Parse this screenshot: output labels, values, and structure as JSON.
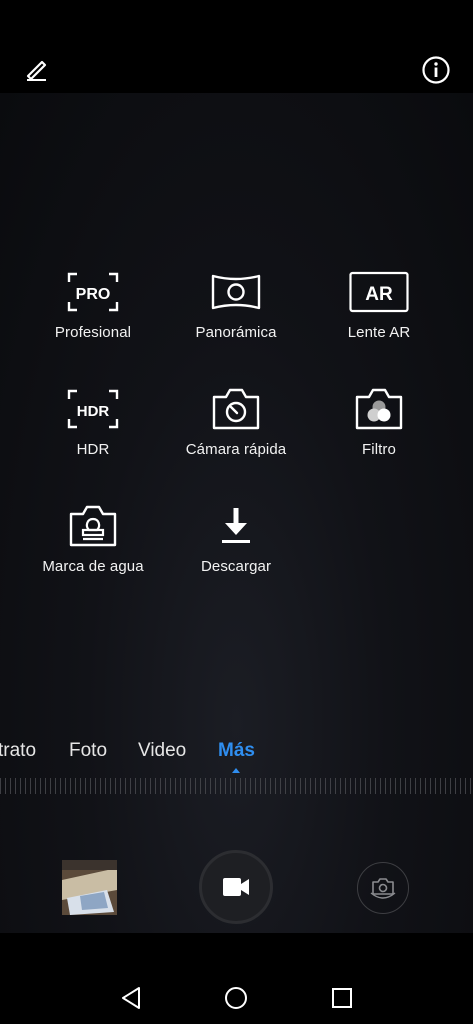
{
  "top": {
    "edit_icon": "edit-pencil-icon",
    "info_icon": "info-icon"
  },
  "modes": [
    {
      "label": "Profesional",
      "icon": "pro-icon",
      "badge": "PRO"
    },
    {
      "label": "Panorámica",
      "icon": "panorama-icon"
    },
    {
      "label": "Lente AR",
      "icon": "ar-icon",
      "badge": "AR"
    },
    {
      "label": "HDR",
      "icon": "hdr-icon",
      "badge": "HDR"
    },
    {
      "label": "Cámara rápida",
      "icon": "time-lapse-icon"
    },
    {
      "label": "Filtro",
      "icon": "filter-icon"
    },
    {
      "label": "Marca de agua",
      "icon": "watermark-icon"
    },
    {
      "label": "Descargar",
      "icon": "download-icon"
    }
  ],
  "tabs": [
    {
      "label": "trato"
    },
    {
      "label": "Foto"
    },
    {
      "label": "Video"
    },
    {
      "label": "Más",
      "active": true
    }
  ],
  "colors": {
    "accent": "#2f8ef0",
    "background": "#000000"
  }
}
